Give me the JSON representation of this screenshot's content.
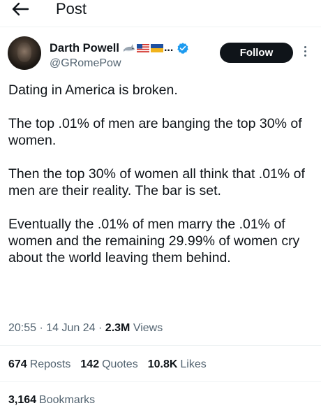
{
  "header": {
    "title": "Post",
    "back_icon": "arrow-left-icon"
  },
  "author": {
    "display_name": "Darth Powell",
    "name_emojis": [
      "shark-emoji",
      "us-flag-emoji",
      "ukraine-flag-emoji"
    ],
    "name_ellipsis": "...",
    "verified": true,
    "verified_color": "#1d9bf0",
    "handle": "@GRomePow"
  },
  "actions": {
    "follow_label": "Follow",
    "more_icon": "more-vertical-icon"
  },
  "tweet": {
    "paragraphs": [
      "Dating in America is broken.",
      "The top .01% of men are banging the top 30% of women.",
      "Then the top 30% of women all think that .01% of men are their reality.  The bar is set.",
      "Eventually the .01% of men marry the .01% of women and the remaining 29.99% of women cry about the world leaving them behind."
    ]
  },
  "meta": {
    "time": "20:55",
    "separator": "·",
    "date": "14 Jun 24",
    "views_count": "2.3M",
    "views_label": "Views"
  },
  "stats": {
    "reposts_count": "674",
    "reposts_label": "Reposts",
    "quotes_count": "142",
    "quotes_label": "Quotes",
    "likes_count": "10.8K",
    "likes_label": "Likes",
    "bookmarks_count": "3,164",
    "bookmarks_label": "Bookmarks"
  },
  "colors": {
    "text_primary": "#0f1419",
    "text_secondary": "#536471",
    "divider": "#eff3f4",
    "follow_bg": "#0f1419",
    "follow_text": "#ffffff"
  }
}
